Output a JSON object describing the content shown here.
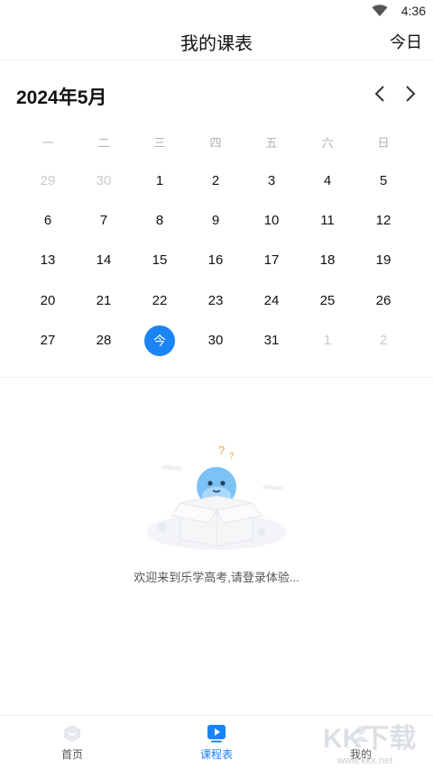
{
  "status_bar": {
    "time": "4:36",
    "wifi_icon": "wifi-icon"
  },
  "header": {
    "title": "我的课表",
    "today_button": "今日"
  },
  "calendar": {
    "month_label": "2024年5月",
    "prev_icon": "chevron-left-icon",
    "next_icon": "chevron-right-icon",
    "weekdays": [
      "一",
      "二",
      "三",
      "四",
      "五",
      "六",
      "日"
    ],
    "days": [
      {
        "label": "29",
        "muted": true
      },
      {
        "label": "30",
        "muted": true
      },
      {
        "label": "1"
      },
      {
        "label": "2"
      },
      {
        "label": "3"
      },
      {
        "label": "4"
      },
      {
        "label": "5"
      },
      {
        "label": "6"
      },
      {
        "label": "7"
      },
      {
        "label": "8"
      },
      {
        "label": "9"
      },
      {
        "label": "10"
      },
      {
        "label": "11"
      },
      {
        "label": "12"
      },
      {
        "label": "13"
      },
      {
        "label": "14"
      },
      {
        "label": "15"
      },
      {
        "label": "16"
      },
      {
        "label": "17"
      },
      {
        "label": "18"
      },
      {
        "label": "19"
      },
      {
        "label": "20"
      },
      {
        "label": "21"
      },
      {
        "label": "22"
      },
      {
        "label": "23"
      },
      {
        "label": "24"
      },
      {
        "label": "25"
      },
      {
        "label": "26"
      },
      {
        "label": "27"
      },
      {
        "label": "28"
      },
      {
        "label": "今",
        "today": true
      },
      {
        "label": "30"
      },
      {
        "label": "31"
      },
      {
        "label": "1",
        "muted": true
      },
      {
        "label": "2",
        "muted": true
      }
    ],
    "accent_color": "#1a84f5"
  },
  "empty_state": {
    "message": "欢迎来到乐学高考,请登录体验...",
    "illustration": "mascot-in-box-illustration"
  },
  "tabbar": {
    "items": [
      {
        "label": "首页",
        "icon": "home-icon",
        "active": false
      },
      {
        "label": "课程表",
        "icon": "schedule-icon",
        "active": true
      },
      {
        "label": "我的",
        "icon": "profile-icon",
        "active": false
      }
    ]
  },
  "watermark": {
    "text": "KK下载",
    "url_text": "www.kkx.net"
  }
}
